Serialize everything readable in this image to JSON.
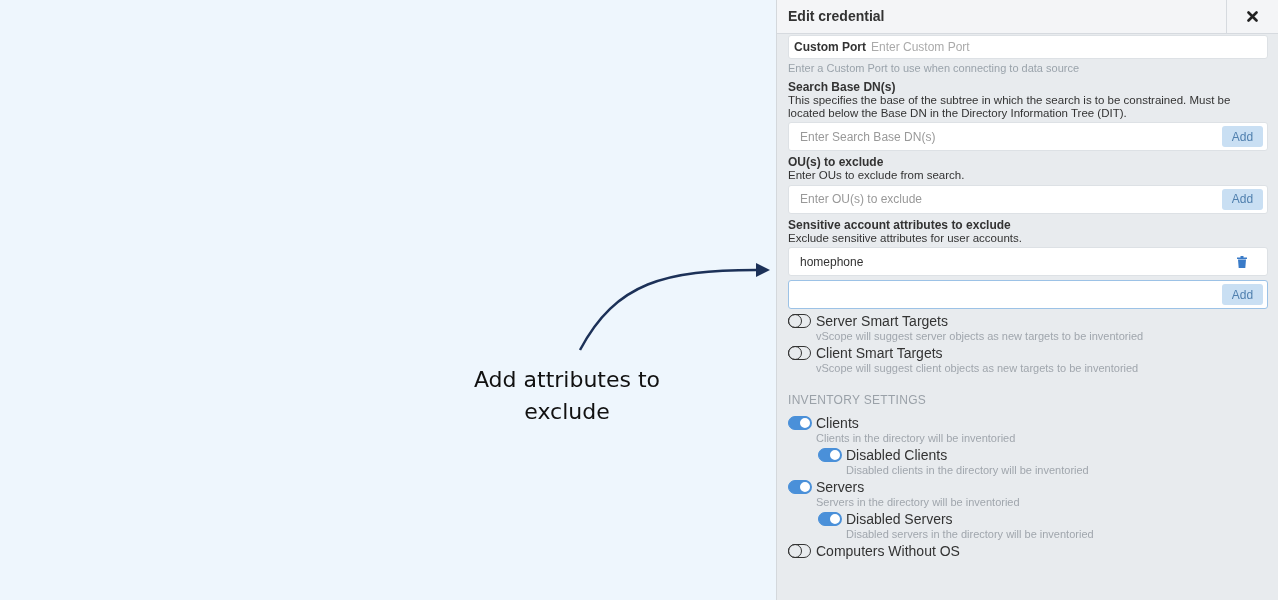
{
  "annotation": {
    "text": "Add attributes to exclude"
  },
  "panel": {
    "title": "Edit credential",
    "custom_port": {
      "label": "Custom Port",
      "placeholder": "Enter Custom Port",
      "help": "Enter a Custom Port to use when connecting to data source"
    },
    "fields": [
      {
        "label": "Search Base DN(s)",
        "description": "This specifies the base of the subtree in which the search is to be constrained. Must be located below the Base DN in the Directory Information Tree (DIT).",
        "placeholder": "Enter Search Base DN(s)",
        "button": {
          "label": "Add",
          "disabled": true
        }
      },
      {
        "label": "OU(s) to exclude",
        "description": "Enter OUs to exclude from search.",
        "placeholder": "Enter OU(s) to exclude",
        "button": {
          "label": "Add",
          "disabled": true
        }
      },
      {
        "label": "Sensitive account attributes to exclude",
        "description": "Exclude sensitive attributes for user accounts.",
        "values": [
          "homephone"
        ],
        "focused": true,
        "button": {
          "label": "Add",
          "disabled": true
        }
      }
    ],
    "toggles": [
      {
        "label": "Server Smart Targets",
        "description": "vScope will suggest server objects as new targets to be inventoried",
        "on": false
      },
      {
        "label": "Client Smart Targets",
        "description": "vScope will suggest client objects as new targets to be inventoried",
        "on": false
      }
    ],
    "section": "INVENTORY SETTINGS",
    "inventory": [
      {
        "label": "Clients",
        "description": "Clients in the directory will be inventoried",
        "on": true,
        "children": [
          {
            "label": "Disabled Clients",
            "description": "Disabled clients in the directory will be inventoried",
            "on": true
          }
        ]
      },
      {
        "label": "Servers",
        "description": "Servers in the directory will be inventoried",
        "on": true,
        "children": [
          {
            "label": "Disabled Servers",
            "description": "Disabled servers in the directory will be inventoried",
            "on": true
          }
        ]
      },
      {
        "label": "Computers Without OS",
        "on": false
      }
    ]
  }
}
